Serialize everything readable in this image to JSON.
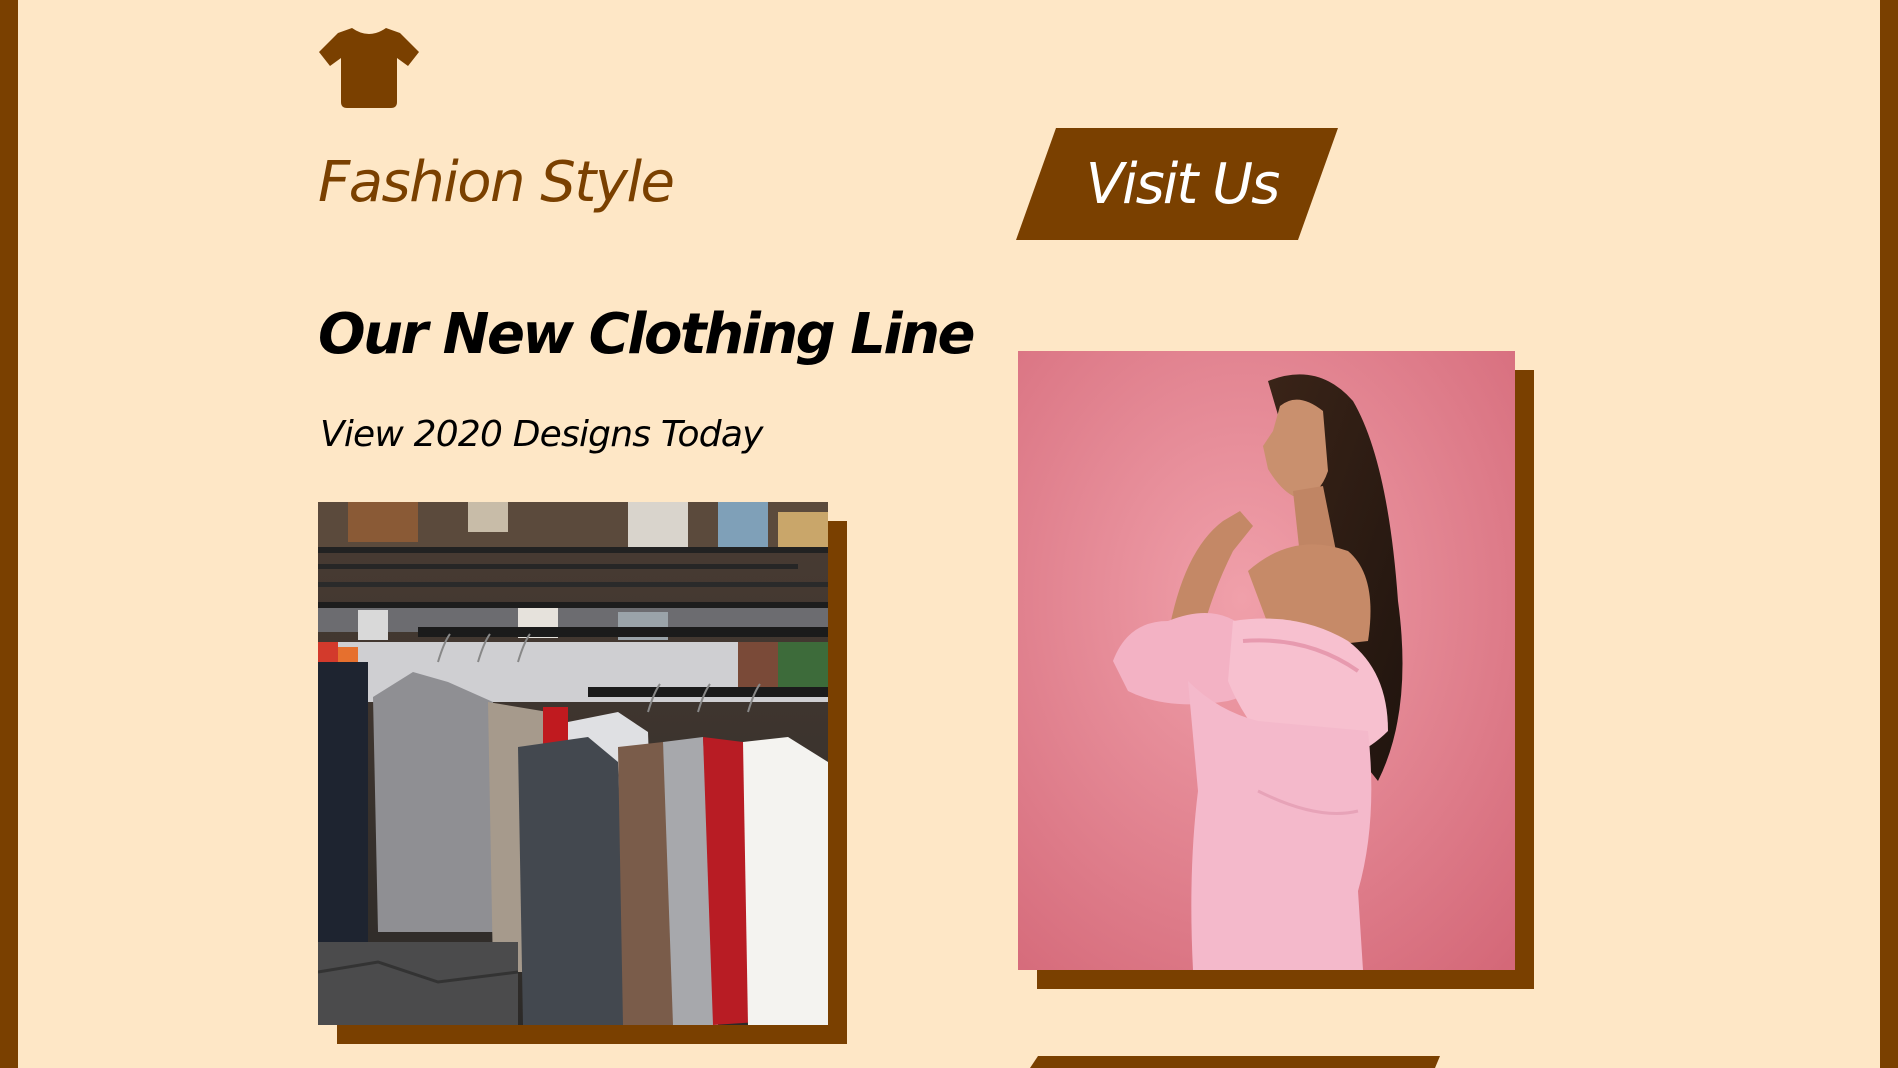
{
  "brand": {
    "logo_icon": "tshirt-icon",
    "title": "Fashion Style"
  },
  "nav": {
    "visit_label": "Visit Us"
  },
  "hero": {
    "headline": "Our New Clothing Line",
    "subheadline": "View 2020 Designs Today"
  },
  "images": {
    "left_photo": "clothing-rack-photo",
    "right_photo": "model-in-pink-dress-photo"
  },
  "colors": {
    "background": "#fee7c6",
    "accent": "#7a4000",
    "heading": "#000000",
    "button_text": "#ffffff"
  }
}
